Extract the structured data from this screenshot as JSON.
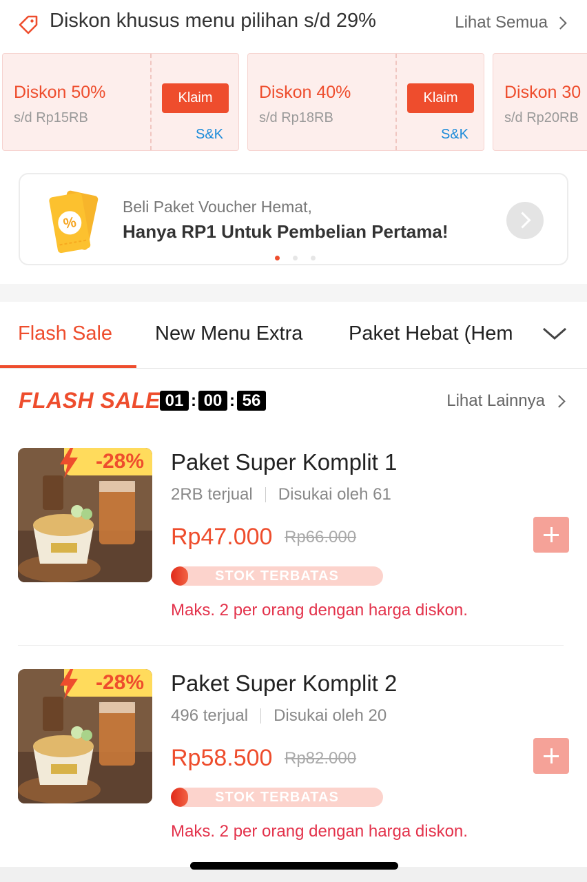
{
  "promo_header": {
    "title": "Diskon khusus menu pilihan s/d 29%",
    "see_all": "Lihat Semua"
  },
  "vouchers": [
    {
      "title": "Diskon 50%",
      "subtitle": "s/d Rp15RB",
      "claim": "Klaim",
      "terms": "S&K"
    },
    {
      "title": "Diskon 40%",
      "subtitle": "s/d Rp18RB",
      "claim": "Klaim",
      "terms": "S&K"
    },
    {
      "title": "Diskon 30",
      "subtitle": "s/d Rp20RB"
    }
  ],
  "banner": {
    "line1": "Beli Paket Voucher Hemat,",
    "line2": "Hanya RP1 Untuk Pembelian Pertama!",
    "active_dot": 1,
    "dot_count": 3
  },
  "tabs": [
    {
      "label": "Flash Sale",
      "active": true
    },
    {
      "label": "New Menu Extra",
      "active": false
    },
    {
      "label": "Paket Hebat (Hem",
      "active": false
    }
  ],
  "flash_sale": {
    "logo": "FLASH SALE",
    "timer": {
      "hours": "01",
      "minutes": "00",
      "seconds": "56"
    },
    "see_more": "Lihat Lainnya"
  },
  "products": [
    {
      "name": "Paket Super Komplit 1",
      "sold": "2RB terjual",
      "liked": "Disukai oleh 61",
      "price": "Rp47.000",
      "old_price": "Rp66.000",
      "discount": "-28%",
      "stock_label": "STOK TERBATAS",
      "stock_level": 0.08,
      "limit_note": "Maks. 2 per orang dengan harga diskon."
    },
    {
      "name": "Paket Super Komplit 2",
      "sold": "496 terjual",
      "liked": "Disukai oleh 20",
      "price": "Rp58.500",
      "old_price": "Rp82.000",
      "discount": "-28%",
      "stock_label": "STOK TERBATAS",
      "stock_level": 0.08,
      "limit_note": "Maks. 2 per orang dengan harga diskon."
    }
  ],
  "colors": {
    "accent": "#ee4d2d",
    "link": "#1a8ad9",
    "limit_text": "#e3324b",
    "badge": "#ffdb5c"
  }
}
